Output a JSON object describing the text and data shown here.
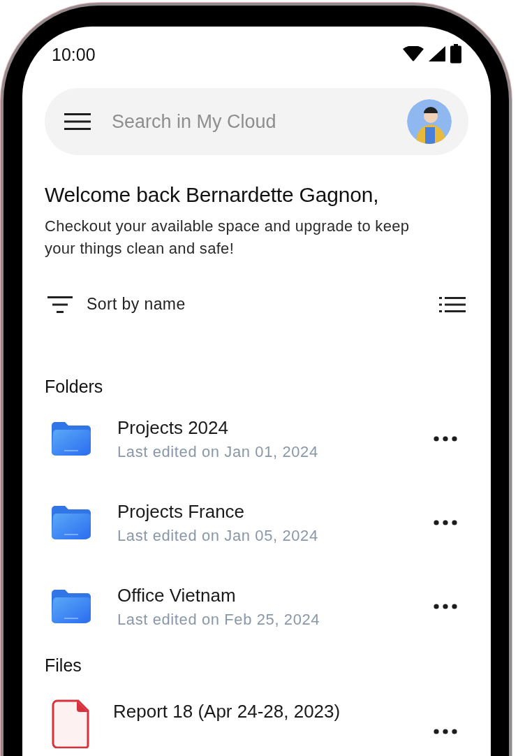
{
  "status_bar": {
    "time": "10:00"
  },
  "search": {
    "placeholder": "Search in My Cloud"
  },
  "welcome": {
    "title": "Welcome back Bernardette Gagnon,",
    "subtitle": "Checkout your available space and upgrade to keep your things clean and safe!"
  },
  "sort": {
    "label": "Sort by name"
  },
  "folders": {
    "heading": "Folders",
    "items": [
      {
        "name": "Projects 2024",
        "edited": "Last edited on Jan 01, 2024"
      },
      {
        "name": "Projects France",
        "edited": "Last edited on Jan 05, 2024"
      },
      {
        "name": "Office Vietnam",
        "edited": "Last edited on Feb 25, 2024"
      }
    ]
  },
  "files": {
    "heading": "Files",
    "items": [
      {
        "name": "Report 18 (Apr 24-28, 2023)",
        "kind": "document"
      }
    ]
  }
}
